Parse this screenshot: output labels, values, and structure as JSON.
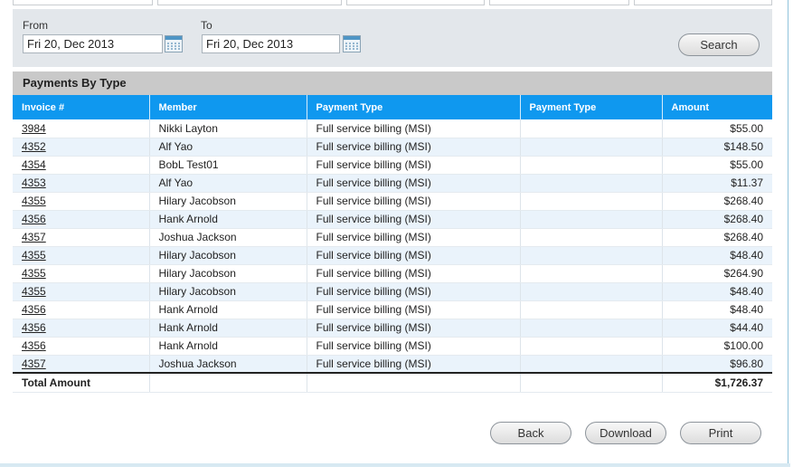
{
  "filters": {
    "from_label": "From",
    "from_value": "Fri 20, Dec 2013",
    "to_label": "To",
    "to_value": "Fri 20, Dec 2013",
    "search_label": "Search"
  },
  "section": {
    "title": "Payments By Type"
  },
  "table": {
    "columns": [
      "Invoice #",
      "Member",
      "Payment Type",
      "Payment Type",
      "Amount"
    ],
    "rows": [
      {
        "invoice": "3984",
        "member": "Nikki Layton",
        "type": "Full service billing (MSI)",
        "type2": "",
        "amount": "$55.00"
      },
      {
        "invoice": "4352",
        "member": "Alf Yao",
        "type": "Full service billing (MSI)",
        "type2": "",
        "amount": "$148.50"
      },
      {
        "invoice": "4354",
        "member": "BobL Test01",
        "type": "Full service billing (MSI)",
        "type2": "",
        "amount": "$55.00"
      },
      {
        "invoice": "4353",
        "member": "Alf Yao",
        "type": "Full service billing (MSI)",
        "type2": "",
        "amount": "$11.37"
      },
      {
        "invoice": "4355",
        "member": "Hilary Jacobson",
        "type": "Full service billing (MSI)",
        "type2": "",
        "amount": "$268.40"
      },
      {
        "invoice": "4356",
        "member": "Hank Arnold",
        "type": "Full service billing (MSI)",
        "type2": "",
        "amount": "$268.40"
      },
      {
        "invoice": "4357",
        "member": "Joshua Jackson",
        "type": "Full service billing (MSI)",
        "type2": "",
        "amount": "$268.40"
      },
      {
        "invoice": "4355",
        "member": "Hilary Jacobson",
        "type": "Full service billing (MSI)",
        "type2": "",
        "amount": "$48.40"
      },
      {
        "invoice": "4355",
        "member": "Hilary Jacobson",
        "type": "Full service billing (MSI)",
        "type2": "",
        "amount": "$264.90"
      },
      {
        "invoice": "4355",
        "member": "Hilary Jacobson",
        "type": "Full service billing (MSI)",
        "type2": "",
        "amount": "$48.40"
      },
      {
        "invoice": "4356",
        "member": "Hank Arnold",
        "type": "Full service billing (MSI)",
        "type2": "",
        "amount": "$48.40"
      },
      {
        "invoice": "4356",
        "member": "Hank Arnold",
        "type": "Full service billing (MSI)",
        "type2": "",
        "amount": "$44.40"
      },
      {
        "invoice": "4356",
        "member": "Hank Arnold",
        "type": "Full service billing (MSI)",
        "type2": "",
        "amount": "$100.00"
      },
      {
        "invoice": "4357",
        "member": "Joshua Jackson",
        "type": "Full service billing (MSI)",
        "type2": "",
        "amount": "$96.80"
      }
    ],
    "total_label": "Total Amount",
    "total_value": "$1,726.37"
  },
  "footer": {
    "back_label": "Back",
    "download_label": "Download",
    "print_label": "Print"
  },
  "icons": {
    "date_picker": "calendar-icon"
  },
  "colors": {
    "header_blue": "#0f98ef",
    "row_alt": "#eaf3fb",
    "panel": "#e3e7eb"
  }
}
